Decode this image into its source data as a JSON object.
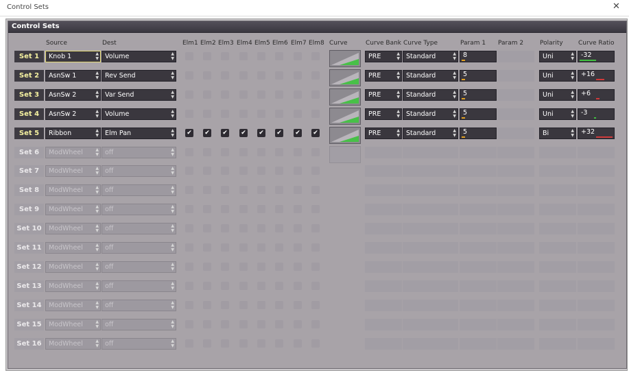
{
  "window": {
    "title": "Control Sets",
    "close_glyph": "✕"
  },
  "panel": {
    "title": "Control Sets"
  },
  "colors": {
    "bar_positive": "#3fbf3f",
    "bar_negative": "#d03a3a",
    "bar_param": "#e0a020"
  },
  "columns": {
    "source": "Source",
    "dest": "Dest",
    "elm": [
      "Elm1",
      "Elm2",
      "Elm3",
      "Elm4",
      "Elm5",
      "Elm6",
      "Elm7",
      "Elm8"
    ],
    "curve": "Curve",
    "curve_bank": "Curve Bank",
    "curve_type": "Curve Type",
    "param1": "Param 1",
    "param2": "Param 2",
    "polarity": "Polarity",
    "curve_ratio": "Curve Ratio"
  },
  "rows": [
    {
      "label": "Set 1",
      "source": "Knob 1",
      "dest": "Volume",
      "elm": [
        false,
        false,
        false,
        false,
        false,
        false,
        false,
        false
      ],
      "curve_bank": "PRE",
      "curve_type": "Standard",
      "param1": "8",
      "polarity": "Uni",
      "curve_ratio": "-32",
      "ratio_value": -32
    },
    {
      "label": "Set 2",
      "source": "AsnSw 1",
      "dest": "Rev Send",
      "elm": [
        false,
        false,
        false,
        false,
        false,
        false,
        false,
        false
      ],
      "curve_bank": "PRE",
      "curve_type": "Standard",
      "param1": "5",
      "polarity": "Uni",
      "curve_ratio": "+16",
      "ratio_value": 16
    },
    {
      "label": "Set 3",
      "source": "AsnSw 2",
      "dest": "Var Send",
      "elm": [
        false,
        false,
        false,
        false,
        false,
        false,
        false,
        false
      ],
      "curve_bank": "PRE",
      "curve_type": "Standard",
      "param1": "5",
      "polarity": "Uni",
      "curve_ratio": "+6",
      "ratio_value": 6
    },
    {
      "label": "Set 4",
      "source": "AsnSw 2",
      "dest": "Volume",
      "elm": [
        false,
        false,
        false,
        false,
        false,
        false,
        false,
        false
      ],
      "curve_bank": "PRE",
      "curve_type": "Standard",
      "param1": "5",
      "polarity": "Uni",
      "curve_ratio": "-3",
      "ratio_value": -3
    },
    {
      "label": "Set 5",
      "source": "Ribbon",
      "dest": "Elm Pan",
      "elm": [
        true,
        true,
        true,
        true,
        true,
        true,
        true,
        true
      ],
      "curve_bank": "PRE",
      "curve_type": "Standard",
      "param1": "5",
      "polarity": "Bi",
      "curve_ratio": "+32",
      "ratio_value": 32
    }
  ],
  "disabled_rows": [
    {
      "label": "Set 6",
      "source": "ModWheel",
      "dest": "off"
    },
    {
      "label": "Set 7",
      "source": "ModWheel",
      "dest": "off"
    },
    {
      "label": "Set 8",
      "source": "ModWheel",
      "dest": "off"
    },
    {
      "label": "Set 9",
      "source": "ModWheel",
      "dest": "off"
    },
    {
      "label": "Set 10",
      "source": "ModWheel",
      "dest": "off"
    },
    {
      "label": "Set 11",
      "source": "ModWheel",
      "dest": "off"
    },
    {
      "label": "Set 12",
      "source": "ModWheel",
      "dest": "off"
    },
    {
      "label": "Set 13",
      "source": "ModWheel",
      "dest": "off"
    },
    {
      "label": "Set 14",
      "source": "ModWheel",
      "dest": "off"
    },
    {
      "label": "Set 15",
      "source": "ModWheel",
      "dest": "off"
    },
    {
      "label": "Set 16",
      "source": "ModWheel",
      "dest": "off"
    }
  ],
  "icons": {
    "dropdown": "updown-arrow-icon",
    "checkbox": "checkmark-icon",
    "curve": "curve-preview-icon"
  }
}
